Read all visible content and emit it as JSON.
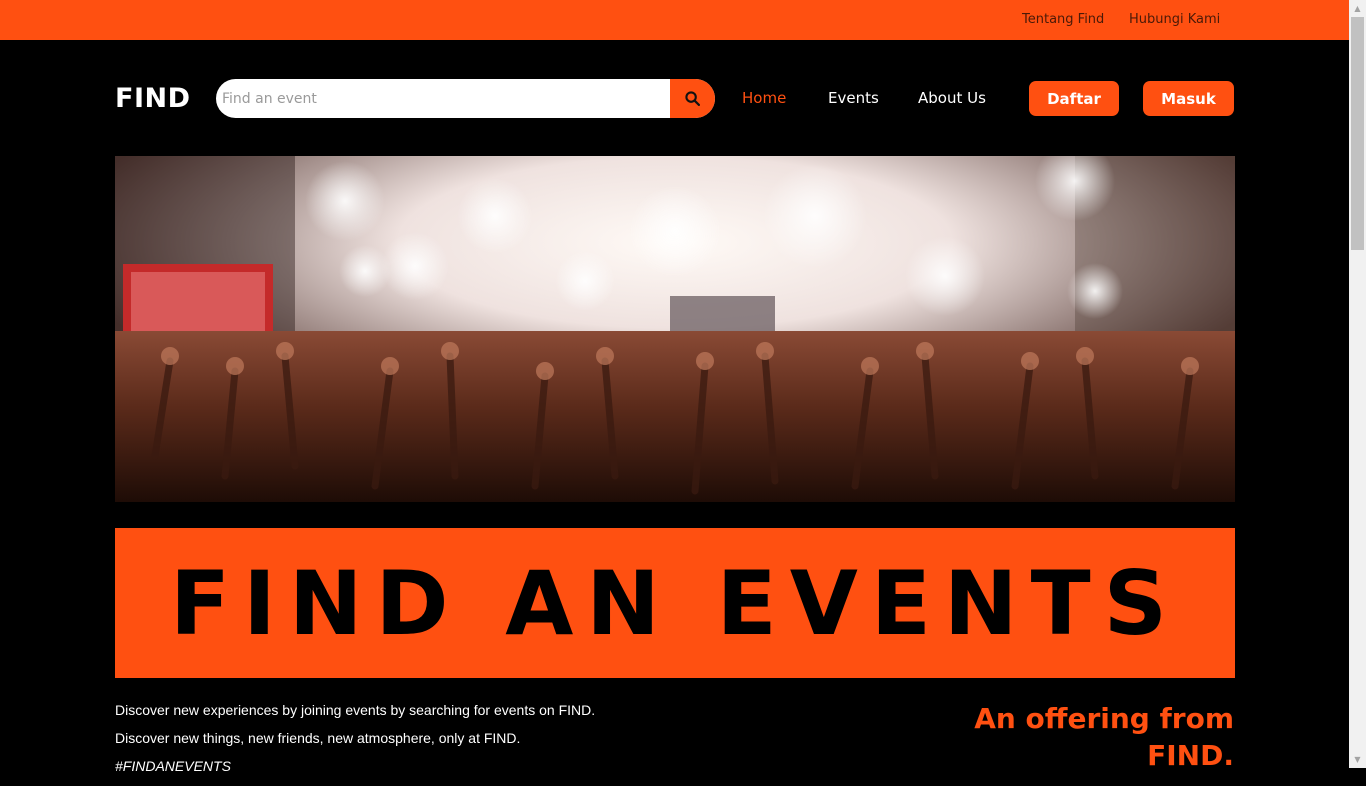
{
  "topbar": {
    "links": [
      "Tentang Find",
      "Hubungi Kami"
    ],
    "background": "#ff5011"
  },
  "header": {
    "logo": "FIND",
    "search": {
      "placeholder": "Find an event",
      "value": "",
      "icon": "search-icon"
    },
    "nav": [
      {
        "label": "Home",
        "active": true
      },
      {
        "label": "Events",
        "active": false
      },
      {
        "label": "About Us",
        "active": false
      }
    ],
    "buttons": {
      "register": "Daftar",
      "login": "Masuk"
    }
  },
  "hero": {
    "image": "concert-crowd-photo"
  },
  "banner": {
    "title": "FIND AN EVENTS"
  },
  "intro": {
    "lines": [
      "Discover new experiences by joining events by searching for events on FIND.",
      "Discover new things, new friends, new atmosphere, only at FIND."
    ],
    "hashtag": "#FINDANEVENTS"
  },
  "offering": {
    "heading": "An offering from FIND."
  },
  "colors": {
    "accent": "#ff5011",
    "background": "#000000",
    "text": "#ffffff"
  }
}
